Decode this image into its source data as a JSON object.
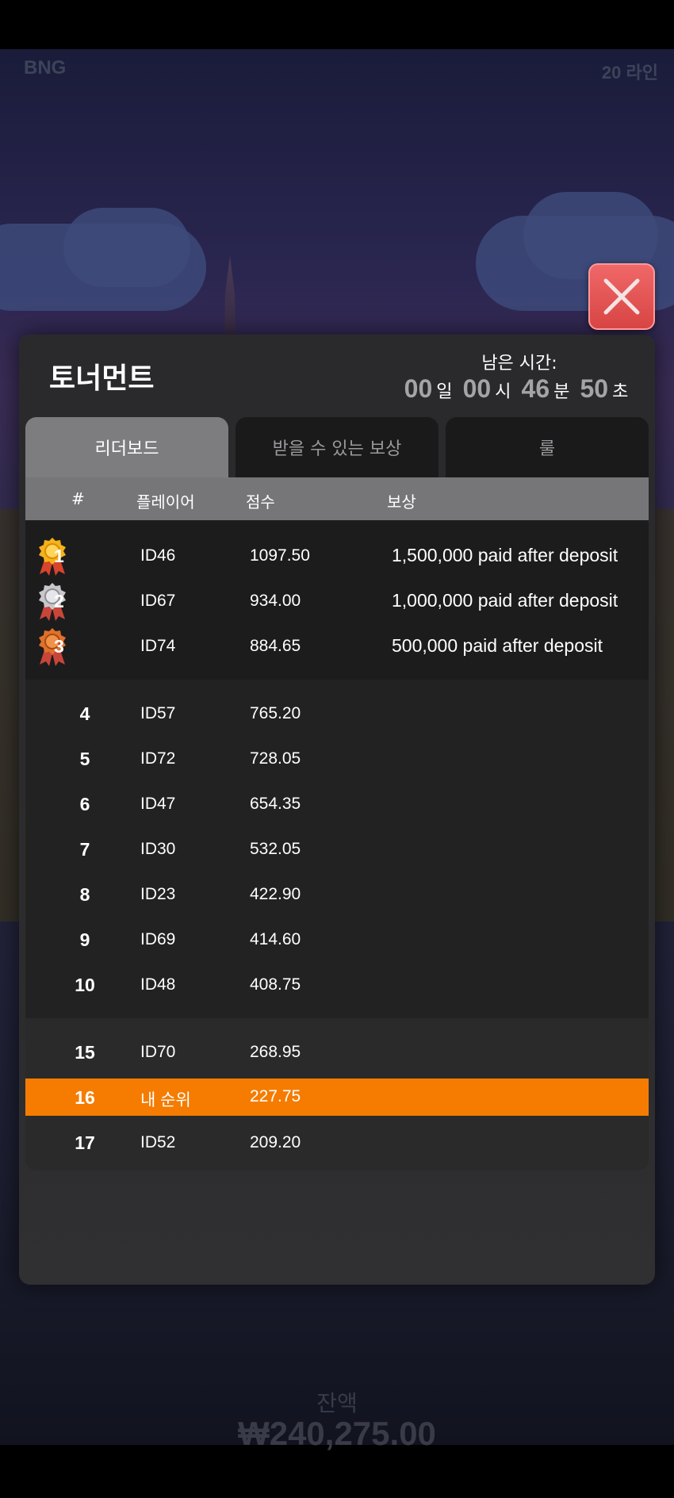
{
  "game": {
    "brand": "BNG",
    "lines": "20 라인",
    "balance_label": "잔액",
    "balance_value": "₩240,275.00"
  },
  "modal": {
    "title": "토너먼트",
    "timer_label": "남은 시간:",
    "timer": {
      "days": "00",
      "days_unit": "일",
      "hours": "00",
      "hours_unit": "시",
      "minutes": "46",
      "minutes_unit": "분",
      "seconds": "50",
      "seconds_unit": "초"
    },
    "tabs": [
      {
        "label": "리더보드",
        "active": true
      },
      {
        "label": "받을 수 있는 보상",
        "active": false
      },
      {
        "label": "룰",
        "active": false
      }
    ],
    "headers": {
      "rank": "#",
      "player": "플레이어",
      "score": "점수",
      "reward": "보상"
    },
    "top_rows": [
      {
        "rank": "1",
        "player": "ID46",
        "score": "1097.50",
        "reward": "1,500,000 paid after deposit",
        "medal": "gold"
      },
      {
        "rank": "2",
        "player": "ID67",
        "score": "934.00",
        "reward": "1,000,000 paid after deposit",
        "medal": "silver"
      },
      {
        "rank": "3",
        "player": "ID74",
        "score": "884.65",
        "reward": "500,000 paid after deposit",
        "medal": "bronze"
      }
    ],
    "mid_rows": [
      {
        "rank": "4",
        "player": "ID57",
        "score": "765.20"
      },
      {
        "rank": "5",
        "player": "ID72",
        "score": "728.05"
      },
      {
        "rank": "6",
        "player": "ID47",
        "score": "654.35"
      },
      {
        "rank": "7",
        "player": "ID30",
        "score": "532.05"
      },
      {
        "rank": "8",
        "player": "ID23",
        "score": "422.90"
      },
      {
        "rank": "9",
        "player": "ID69",
        "score": "414.60"
      },
      {
        "rank": "10",
        "player": "ID48",
        "score": "408.75"
      }
    ],
    "bottom_rows": [
      {
        "rank": "15",
        "player": "ID70",
        "score": "268.95",
        "me": false
      },
      {
        "rank": "16",
        "player": "내 순위",
        "score": "227.75",
        "me": true
      },
      {
        "rank": "17",
        "player": "ID52",
        "score": "209.20",
        "me": false
      }
    ]
  },
  "colors": {
    "highlight": "#f57c00",
    "close": "#e65555",
    "medal_gold": "#f5b21a",
    "medal_silver": "#c8c8cc",
    "medal_bronze": "#e0702a"
  }
}
